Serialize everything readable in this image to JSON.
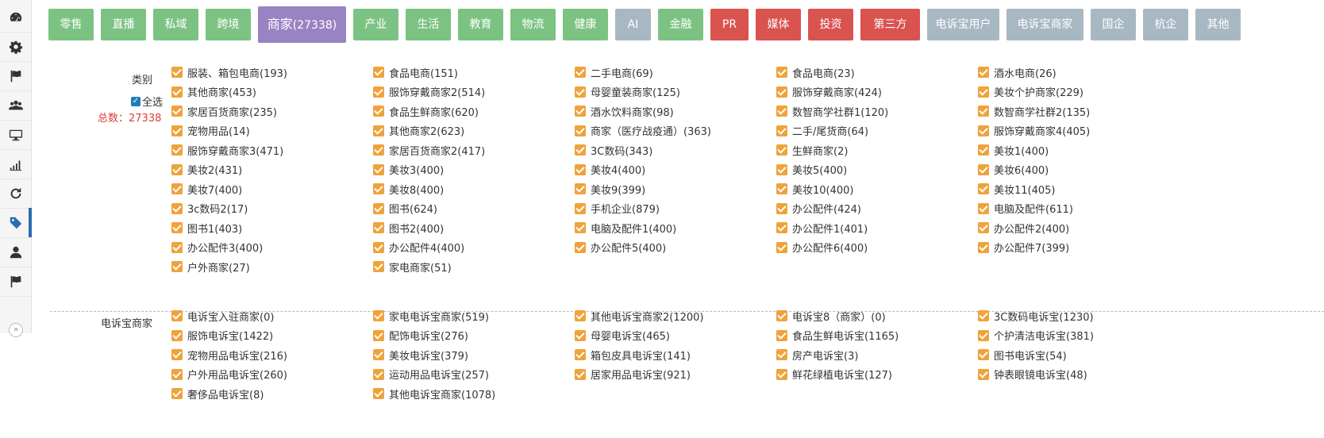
{
  "sidebar": {
    "items": [
      {
        "icon": "dashboard-icon"
      },
      {
        "icon": "gear-icon"
      },
      {
        "icon": "flag-icon"
      },
      {
        "icon": "users-icon"
      },
      {
        "icon": "monitor-icon"
      },
      {
        "icon": "signal-bars-icon"
      },
      {
        "icon": "refresh-icon"
      },
      {
        "icon": "tag-icon",
        "active": true
      },
      {
        "icon": "user-icon"
      },
      {
        "icon": "flag-icon"
      }
    ],
    "toggle_label": "»"
  },
  "tabs": [
    {
      "label": "零售",
      "color": "green"
    },
    {
      "label": "直播",
      "color": "green"
    },
    {
      "label": "私域",
      "color": "green"
    },
    {
      "label": "跨境",
      "color": "green"
    },
    {
      "label": "商家",
      "count": "(27338)",
      "color": "purple",
      "active": true
    },
    {
      "label": "产业",
      "color": "green"
    },
    {
      "label": "生活",
      "color": "green"
    },
    {
      "label": "教育",
      "color": "green"
    },
    {
      "label": "物流",
      "color": "green"
    },
    {
      "label": "健康",
      "color": "green"
    },
    {
      "label": "AI",
      "color": "gray"
    },
    {
      "label": "金融",
      "color": "green"
    },
    {
      "label": "PR",
      "color": "red"
    },
    {
      "label": "媒体",
      "color": "red"
    },
    {
      "label": "投资",
      "color": "red"
    },
    {
      "label": "第三方",
      "color": "red"
    },
    {
      "label": "电诉宝用户",
      "color": "gray"
    },
    {
      "label": "电诉宝商家",
      "color": "gray"
    },
    {
      "label": "国企",
      "color": "gray"
    },
    {
      "label": "杭企",
      "color": "gray"
    },
    {
      "label": "其他",
      "color": "gray"
    }
  ],
  "category": {
    "label": "类别",
    "select_all": "全选",
    "total": "总数：27338",
    "items": [
      "服装、箱包电商(193)",
      "食品电商(151)",
      "二手电商(69)",
      "食品电商(23)",
      "酒水电商(26)",
      "其他商家(453)",
      "服饰穿戴商家2(514)",
      "母婴童装商家(125)",
      "服饰穿戴商家(424)",
      "美妆个护商家(229)",
      "家居百货商家(235)",
      "食品生鲜商家(620)",
      "酒水饮料商家(98)",
      "数智商学社群1(120)",
      "数智商学社群2(135)",
      "宠物用品(14)",
      "其他商家2(623)",
      "商家（医疗战疫通）(363)",
      "二手/尾货商(64)",
      "服饰穿戴商家4(405)",
      "服饰穿戴商家3(471)",
      "家居百货商家2(417)",
      "3C数码(343)",
      "生鲜商家(2)",
      "美妆1(400)",
      "美妆2(431)",
      "美妆3(400)",
      "美妆4(400)",
      "美妆5(400)",
      "美妆6(400)",
      "美妆7(400)",
      "美妆8(400)",
      "美妆9(399)",
      "美妆10(400)",
      "美妆11(405)",
      "3c数码2(17)",
      "图书(624)",
      "手机企业(879)",
      "办公配件(424)",
      "电脑及配件(611)",
      "图书1(403)",
      "图书2(400)",
      "电脑及配件1(400)",
      "办公配件1(401)",
      "办公配件2(400)",
      "办公配件3(400)",
      "办公配件4(400)",
      "办公配件5(400)",
      "办公配件6(400)",
      "办公配件7(399)",
      "户外商家(27)",
      "家电商家(51)"
    ]
  },
  "dsb_merchant": {
    "label": "电诉宝商家",
    "items": [
      "电诉宝入驻商家(0)",
      "家电电诉宝商家(519)",
      "其他电诉宝商家2(1200)",
      "电诉宝8（商家）(0)",
      "3C数码电诉宝(1230)",
      "服饰电诉宝(1422)",
      "配饰电诉宝(276)",
      "母婴电诉宝(465)",
      "食品生鲜电诉宝(1165)",
      "个护清洁电诉宝(381)",
      "宠物用品电诉宝(216)",
      "美妆电诉宝(379)",
      "箱包皮具电诉宝(141)",
      "房产电诉宝(3)",
      "图书电诉宝(54)",
      "户外用品电诉宝(260)",
      "运动用品电诉宝(257)",
      "居家用品电诉宝(921)",
      "鲜花绿植电诉宝(127)",
      "钟表眼镜电诉宝(48)",
      "奢侈品电诉宝(8)",
      "其他电诉宝商家(1078)"
    ]
  },
  "colors": {
    "green": "#7cc383",
    "gray": "#a8b8c2",
    "red": "#d9534f",
    "purple": "#9a83c2",
    "checkbox": "#f0a23b",
    "total": "#e03a3a"
  }
}
